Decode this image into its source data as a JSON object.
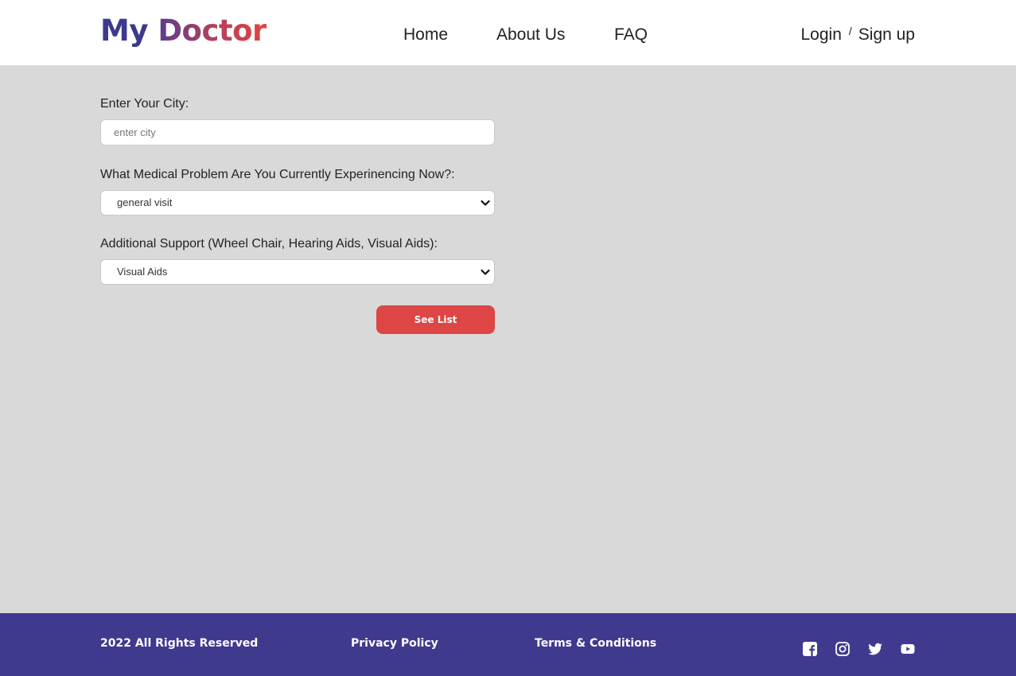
{
  "header": {
    "logo_my": "My",
    "logo_doctor": "Doctor",
    "nav": {
      "home": "Home",
      "about": "About Us",
      "faq": "FAQ"
    },
    "auth": {
      "login": "Login",
      "separator": "/",
      "signup": "Sign up"
    }
  },
  "form": {
    "city": {
      "label": "Enter Your City:",
      "placeholder": "enter city",
      "value": ""
    },
    "problem": {
      "label": "What Medical Problem Are You Currently Experinencing Now?:",
      "selected": "general visit"
    },
    "support": {
      "label": "Additional Support (Wheel Chair, Hearing Aids, Visual Aids):",
      "selected": "Visual Aids"
    },
    "submit_label": "See List"
  },
  "footer": {
    "copyright": "2022 All Rights Reserved",
    "privacy": "Privacy Policy",
    "terms": "Terms & Conditions",
    "social_icons": [
      "facebook-icon",
      "instagram-icon",
      "twitter-icon",
      "youtube-icon"
    ]
  },
  "colors": {
    "brand_blue": "#3f3a8e",
    "brand_red": "#de4545",
    "page_bg": "#d9d9d9"
  }
}
